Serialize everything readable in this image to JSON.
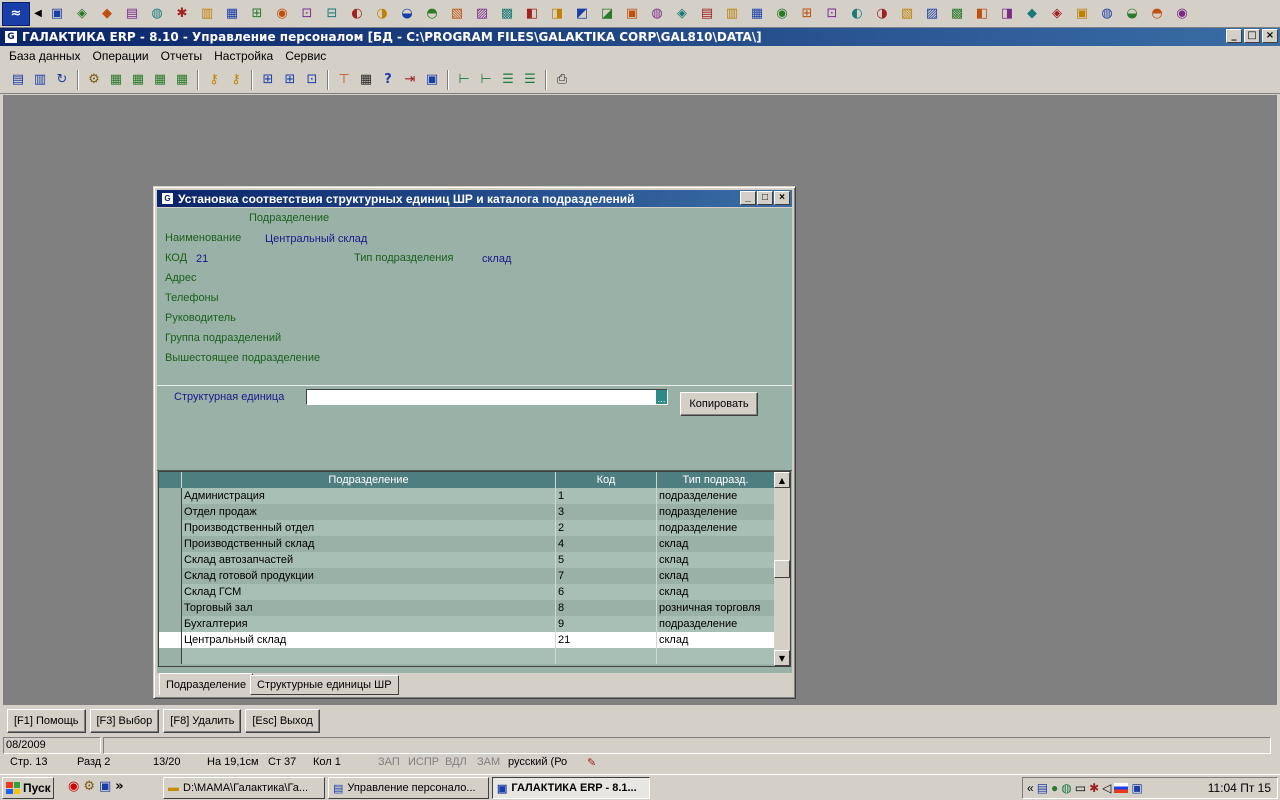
{
  "quickbar": {
    "icons": [
      "app-logo-icon",
      "nav-left-icon",
      "ql-icon-1",
      "ql-icon-2",
      "ql-icon-3",
      "ql-icon-4",
      "ql-icon-5",
      "ql-icon-6",
      "ql-icon-7",
      "ql-icon-8",
      "ql-icon-9",
      "ql-icon-10",
      "ql-icon-11",
      "ql-icon-12",
      "ql-icon-13",
      "ql-icon-14",
      "ql-icon-15",
      "ql-icon-16",
      "ql-icon-17",
      "ql-icon-18",
      "ql-icon-19",
      "ql-icon-20",
      "ql-icon-21",
      "ql-icon-22",
      "ql-icon-23",
      "ql-icon-24",
      "ql-icon-25",
      "ql-icon-26",
      "ql-icon-27",
      "ql-icon-28",
      "ql-icon-29",
      "ql-icon-30",
      "ql-icon-31",
      "ql-icon-32",
      "ql-icon-33",
      "ql-icon-34",
      "ql-icon-35",
      "ql-icon-36",
      "ql-icon-37",
      "ql-icon-38",
      "ql-icon-39",
      "ql-icon-40",
      "ql-icon-41",
      "ql-icon-42",
      "ql-icon-43",
      "ql-icon-44",
      "ql-icon-45",
      "ql-icon-46"
    ]
  },
  "main_window": {
    "title": "ГАЛАКТИКА ERP - 8.10 - Управление персоналом [БД - C:\\PROGRAM FILES\\GALAKTIKA CORP\\GAL810\\DATA\\]"
  },
  "menu": [
    "База данных",
    "Операции",
    "Отчеты",
    "Настройка",
    "Сервис"
  ],
  "dialog": {
    "title": "Установка соответствия структурных единиц ШР и каталога подразделений",
    "section_header": "Подразделение",
    "fields": {
      "name_label": "Наименование",
      "name_value": "Центральный склад",
      "code_label": "КОД",
      "code_value": "21",
      "type_label": "Тип подразделения",
      "type_value": "склад",
      "address_label": "Адрес",
      "phones_label": "Телефоны",
      "head_label": "Руководитель",
      "group_label": "Группа подразделений",
      "parent_label": "Вышестоящее подразделение"
    },
    "struct_label": "Структурная единица",
    "struct_value": "",
    "copy_button": "Копировать",
    "grid": {
      "columns": [
        "Подразделение",
        "Код",
        "Тип подразд."
      ],
      "rows": [
        [
          "Администрация",
          "1",
          "подразделение"
        ],
        [
          "Отдел продаж",
          "3",
          "подразделение"
        ],
        [
          "Производственный отдел",
          "2",
          "подразделение"
        ],
        [
          "Производственный склад",
          "4",
          "склад"
        ],
        [
          "Склад автозапчастей",
          "5",
          "склад"
        ],
        [
          "Склад готовой продукции",
          "7",
          "склад"
        ],
        [
          "Склад ГСМ",
          "6",
          "склад"
        ],
        [
          "Торговый зал",
          "8",
          "розничная торговля"
        ],
        [
          "Бухгалтерия",
          "9",
          "подразделение"
        ],
        [
          "Центральный склад",
          "21",
          "склад"
        ]
      ],
      "selected_index": 9
    },
    "tabs": [
      "Подразделение",
      "Структурные единицы ШР"
    ],
    "active_tab": 0
  },
  "fkeys": [
    "[F1] Помощь",
    "[F3] Выбор",
    "[F8] Удалить",
    "[Esc] Выход"
  ],
  "status": {
    "period": "08/2009",
    "page": "Стр. 13",
    "section": "Разд  2",
    "pos": "13/20",
    "at": "На 19,1см",
    "line": "Ст 37",
    "col": "Кол  1",
    "zap": "ЗАП",
    "ispr": "ИСПР",
    "vdl": "ВДЛ",
    "zam": "ЗАМ",
    "lang": "русский (Ро"
  },
  "taskbar": {
    "start": "Пуск",
    "tasks": [
      "D:\\МАМА\\Галактика\\Га...",
      "Управление персонало...",
      "ГАЛАКТИКА ERP - 8.1..."
    ],
    "active_task": 2,
    "clock": "11:04 Пт 15"
  }
}
